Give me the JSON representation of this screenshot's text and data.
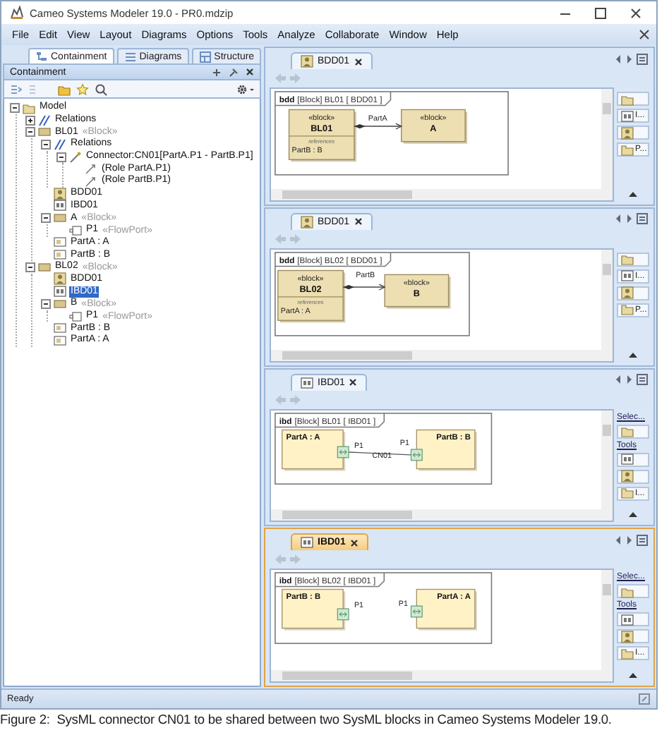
{
  "window": {
    "title": "Cameo Systems Modeler 19.0 - PR0.mdzip"
  },
  "menu": [
    "File",
    "Edit",
    "View",
    "Layout",
    "Diagrams",
    "Options",
    "Tools",
    "Analyze",
    "Collaborate",
    "Window",
    "Help"
  ],
  "browser": {
    "tabs": [
      {
        "label": "Containment",
        "selected": true
      },
      {
        "label": "Diagrams",
        "selected": false
      },
      {
        "label": "Structure",
        "selected": false
      }
    ],
    "title": "Containment",
    "tree": [
      {
        "label": "Model",
        "kind": "model",
        "expanded": true,
        "selected": false,
        "children": [
          {
            "label": "Relations",
            "kind": "relations",
            "expanded": false,
            "selected": false
          },
          {
            "label": "BL01",
            "stereotype": "«Block»",
            "kind": "block",
            "expanded": true,
            "selected": false,
            "children": [
              {
                "label": "Relations",
                "kind": "relations",
                "expanded": true,
                "selected": false,
                "children": [
                  {
                    "label": "Connector:CN01[PartA.P1 - PartB.P1]",
                    "kind": "connector",
                    "expanded": true,
                    "selected": false,
                    "children": [
                      {
                        "label": "(Role PartA.P1)",
                        "kind": "role",
                        "selected": false
                      },
                      {
                        "label": "(Role PartB.P1)",
                        "kind": "role",
                        "selected": false
                      }
                    ]
                  }
                ]
              },
              {
                "label": "BDD01",
                "kind": "bdd",
                "selected": false
              },
              {
                "label": "IBD01",
                "kind": "ibd",
                "selected": false
              },
              {
                "label": "A",
                "stereotype": "«Block»",
                "kind": "block",
                "expanded": true,
                "selected": false,
                "children": [
                  {
                    "label": "P1",
                    "stereotype": "«FlowPort»",
                    "kind": "port",
                    "selected": false
                  }
                ]
              },
              {
                "label": "PartA : A",
                "kind": "part",
                "selected": false
              },
              {
                "label": "PartB : B",
                "kind": "part",
                "selected": false
              }
            ]
          },
          {
            "label": "BL02",
            "stereotype": "«Block»",
            "kind": "block",
            "expanded": true,
            "selected": false,
            "children": [
              {
                "label": "BDD01",
                "kind": "bdd",
                "selected": false
              },
              {
                "label": "IBD01",
                "kind": "ibd",
                "selected": true
              },
              {
                "label": "B",
                "stereotype": "«Block»",
                "kind": "block",
                "expanded": true,
                "selected": false,
                "children": [
                  {
                    "label": "P1",
                    "stereotype": "«FlowPort»",
                    "kind": "port",
                    "selected": false
                  }
                ]
              },
              {
                "label": "PartB : B",
                "kind": "part",
                "selected": false
              },
              {
                "label": "PartA : A",
                "kind": "part",
                "selected": false
              }
            ]
          }
        ]
      }
    ]
  },
  "diagrams": [
    {
      "tab": "BDD01",
      "selected": false,
      "kind": "bdd",
      "type_label": "bdd",
      "header": "[Block] BL01 [ BDD01 ]",
      "blocks": [
        {
          "stereotype": "«block»",
          "name": "BL01",
          "compartment": "references",
          "properties": [
            "PartB : B"
          ]
        },
        {
          "stereotype": "«block»",
          "name": "A"
        }
      ],
      "association": "PartA",
      "palette": [
        {
          "kind": "tool"
        },
        {
          "kind": "tool",
          "label": "I..."
        },
        {
          "kind": "tool"
        },
        {
          "kind": "tool",
          "label": "P..."
        }
      ]
    },
    {
      "tab": "BDD01",
      "selected": false,
      "kind": "bdd",
      "type_label": "bdd",
      "header": "[Block] BL02 [ BDD01 ]",
      "blocks": [
        {
          "stereotype": "«block»",
          "name": "BL02",
          "compartment": "references",
          "properties": [
            "PartA : A"
          ]
        },
        {
          "stereotype": "«block»",
          "name": "B"
        }
      ],
      "association": "PartB",
      "palette": [
        {
          "kind": "tool"
        },
        {
          "kind": "tool",
          "label": "I..."
        },
        {
          "kind": "tool"
        },
        {
          "kind": "tool",
          "label": "P..."
        }
      ]
    },
    {
      "tab": "IBD01",
      "selected": false,
      "kind": "ibd",
      "type_label": "ibd",
      "header": "[Block] BL01 [ IBD01 ]",
      "parts": [
        {
          "name": "PartA : A",
          "port": "P1"
        },
        {
          "name": "PartB : B",
          "port": "P1"
        }
      ],
      "connector": "CN01",
      "palette": [
        {
          "kind": "header",
          "label": "Selec..."
        },
        {
          "kind": "tool"
        },
        {
          "kind": "header",
          "label": "Tools"
        },
        {
          "kind": "tool"
        },
        {
          "kind": "tool"
        },
        {
          "kind": "tool",
          "label": "I..."
        }
      ]
    },
    {
      "tab": "IBD01",
      "selected": true,
      "kind": "ibd",
      "type_label": "ibd",
      "header": "[Block] BL02 [ IBD01 ]",
      "parts": [
        {
          "name": "PartB : B",
          "port": "P1"
        },
        {
          "name": "PartA : A",
          "port": "P1"
        }
      ],
      "palette": [
        {
          "kind": "header",
          "label": "Selec..."
        },
        {
          "kind": "tool"
        },
        {
          "kind": "header",
          "label": "Tools"
        },
        {
          "kind": "tool"
        },
        {
          "kind": "tool"
        },
        {
          "kind": "tool",
          "label": "I..."
        }
      ]
    }
  ],
  "status_bar": "Ready",
  "caption": "Figure 2:  SysML connector CN01 to be shared between two SysML blocks in Cameo Systems Modeler 19.0."
}
